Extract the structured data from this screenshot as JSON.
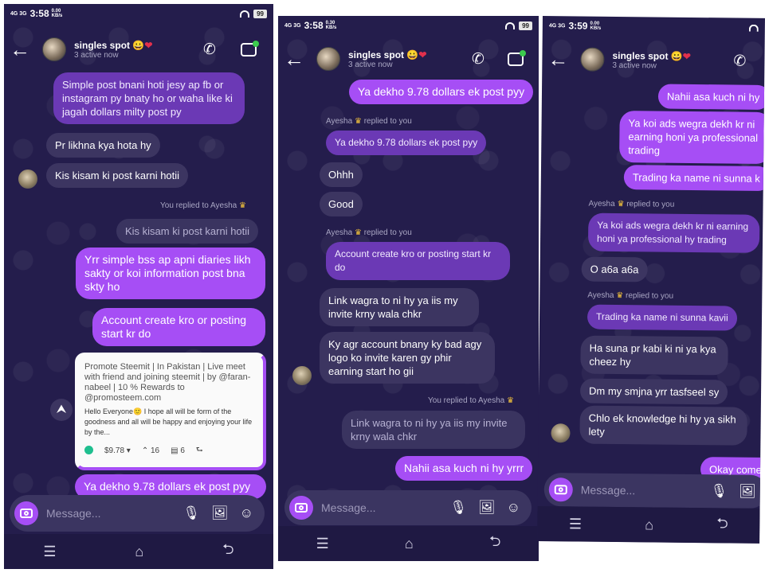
{
  "common": {
    "contact_name": "singles spot",
    "contact_emoji": "😀",
    "contact_heart": "❤",
    "active": "3 active now",
    "placeholder": "Message...",
    "signal": "4G 3G",
    "battery": "99",
    "back_icon": "←",
    "call_icon": "✆",
    "nav_menu": "☰",
    "nav_home": "⌂",
    "nav_back": "⮌"
  },
  "screens": [
    {
      "time": "3:58",
      "speed": "0.00 KB/s",
      "messages": [
        {
          "text": "Simple post bnani hoti jesy ap fb or instagram py bnaty ho or waha like ki jagah dollars milty post py"
        },
        {
          "text": "Pr likhna kya hota hy"
        },
        {
          "text": "Kis kisam ki post karni hotii"
        },
        {
          "text": "You replied to Ayesha"
        },
        {
          "text": "Kis kisam ki post karni hotii"
        },
        {
          "text": "Yrr simple bss ap apni diaries likh sakty or koi information post bna skty ho"
        },
        {
          "text": "Account create kro or posting start kr do"
        },
        {
          "text": "Ya dekho 9.78 dollars ek post pyy"
        }
      ],
      "card": {
        "title": "Promote Steemit | In Pakistan | Live meet with friend and joining steemit | by @faran-nabeel | 10 % Rewards to @promosteem.com",
        "body": "Hello Everyone🙂 I hope all will be form of the goodness and all will be happy and enjoying your life by the...",
        "payout": "$9.78 ▾",
        "votes": "⌃ 16",
        "comments": "▤ 6",
        "share": "⮑"
      }
    },
    {
      "time": "3:58",
      "speed": "0.30 KB/s",
      "messages": [
        {
          "text": "Ya dekho 9.78 dollars ek post pyy"
        },
        {
          "text": "Ayesha"
        },
        {
          "text": "replied to you"
        },
        {
          "text": "Ya dekho 9.78 dollars ek post pyy"
        },
        {
          "text": "Ohhh"
        },
        {
          "text": "Good"
        },
        {
          "text": "Ayesha"
        },
        {
          "text": "replied to you"
        },
        {
          "text": "Account create kro or posting start kr do"
        },
        {
          "text": "Link wagra to ni hy ya iis my invite krny wala chkr"
        },
        {
          "text": "Ky agr account bnany ky bad agy logo ko invite karen gy phir earning start ho gii"
        },
        {
          "text": "You replied to Ayesha"
        },
        {
          "text": "Link wagra to ni hy ya iis my invite krny wala chkr"
        },
        {
          "text": "Nahii asa kuch ni hy yrrr"
        }
      ]
    },
    {
      "time": "3:59",
      "speed": "0.00 KB/s",
      "messages": [
        {
          "text": "Nahii asa kuch ni hy"
        },
        {
          "text": "Ya koi ads wegra dekh kr ni earning honi ya professional trading"
        },
        {
          "text": "Trading ka name ni sunna k"
        },
        {
          "text": "Ayesha"
        },
        {
          "text": "replied to you"
        },
        {
          "text": "Ya koi ads wegra dekh kr ni earning honi ya professional hy trading"
        },
        {
          "text": "O a6a a6a"
        },
        {
          "text": "Ayesha"
        },
        {
          "text": "replied to you"
        },
        {
          "text": "Trading ka name ni sunna kavii"
        },
        {
          "text": "Ha suna pr kabi ki ni ya kya cheez hy"
        },
        {
          "text": "Dm my smjna yrr tasfseel sy"
        },
        {
          "text": "Chlo ek knowledge hi hy ya sikh lety"
        },
        {
          "text": "Okay come"
        }
      ]
    }
  ]
}
